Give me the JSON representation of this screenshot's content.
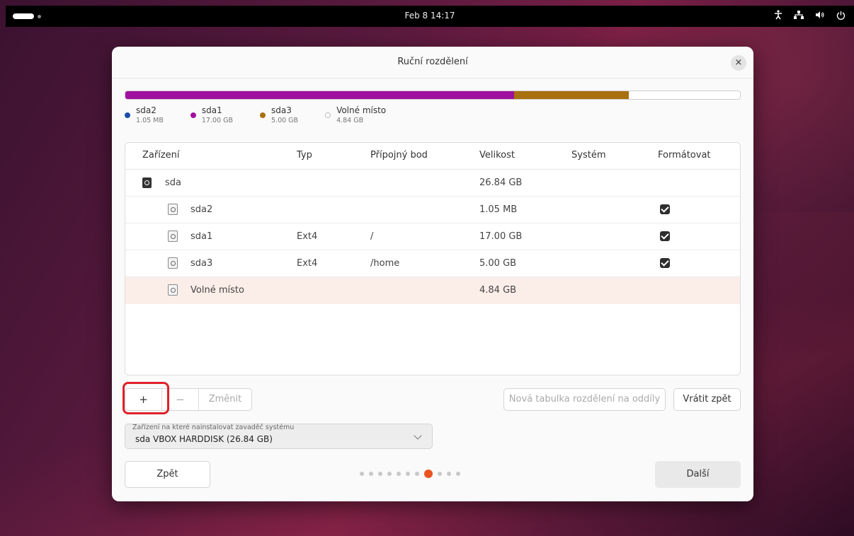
{
  "topbar": {
    "clock": "Feb 8  14:17",
    "tray_icons": [
      "accessibility-icon",
      "network-icon",
      "volume-icon",
      "power-icon"
    ]
  },
  "dialog": {
    "title": "Ruční rozdělení",
    "close_label": "×"
  },
  "usage": {
    "segments": [
      {
        "name": "sda2",
        "size": "1.05 MB",
        "color": "#1c4ea8",
        "fraction": 0.0
      },
      {
        "name": "sda1",
        "size": "17.00 GB",
        "color": "#a0109e",
        "fraction": 0.633
      },
      {
        "name": "sda3",
        "size": "5.00 GB",
        "color": "#a8700f",
        "fraction": 0.186
      },
      {
        "name": "Volné místo",
        "size": "4.84 GB",
        "color": "#ffffff",
        "fraction": 0.181
      }
    ]
  },
  "table": {
    "headers": [
      "Zařízení",
      "Typ",
      "Přípojný bod",
      "Velikost",
      "Systém",
      "Formátovat"
    ],
    "rows": [
      {
        "device": "sda",
        "type": "",
        "mount": "",
        "size": "26.84 GB",
        "system": "",
        "format": false,
        "level": 0,
        "selected": false
      },
      {
        "device": "sda2",
        "type": "",
        "mount": "",
        "size": "1.05 MB",
        "system": "",
        "format": true,
        "level": 1,
        "selected": false
      },
      {
        "device": "sda1",
        "type": "Ext4",
        "mount": "/",
        "size": "17.00 GB",
        "system": "",
        "format": true,
        "level": 1,
        "selected": false
      },
      {
        "device": "sda3",
        "type": "Ext4",
        "mount": "/home",
        "size": "5.00 GB",
        "system": "",
        "format": true,
        "level": 1,
        "selected": false
      },
      {
        "device": "Volné místo",
        "type": "",
        "mount": "",
        "size": "4.84 GB",
        "system": "",
        "format": false,
        "level": 1,
        "selected": true
      }
    ]
  },
  "controls": {
    "add_label": "+",
    "remove_label": "−",
    "change_label": "Změnit",
    "new_table_label": "Nová tabulka rozdělení na oddíly",
    "revert_label": "Vrátit zpět"
  },
  "bootloader": {
    "label": "Zařízení na které nainstalovat zavaděč systému",
    "value": "sda VBOX HARDDISK (26.84 GB)"
  },
  "nav": {
    "back_label": "Zpět",
    "next_label": "Další",
    "page_count": 11,
    "current_page": 8
  }
}
